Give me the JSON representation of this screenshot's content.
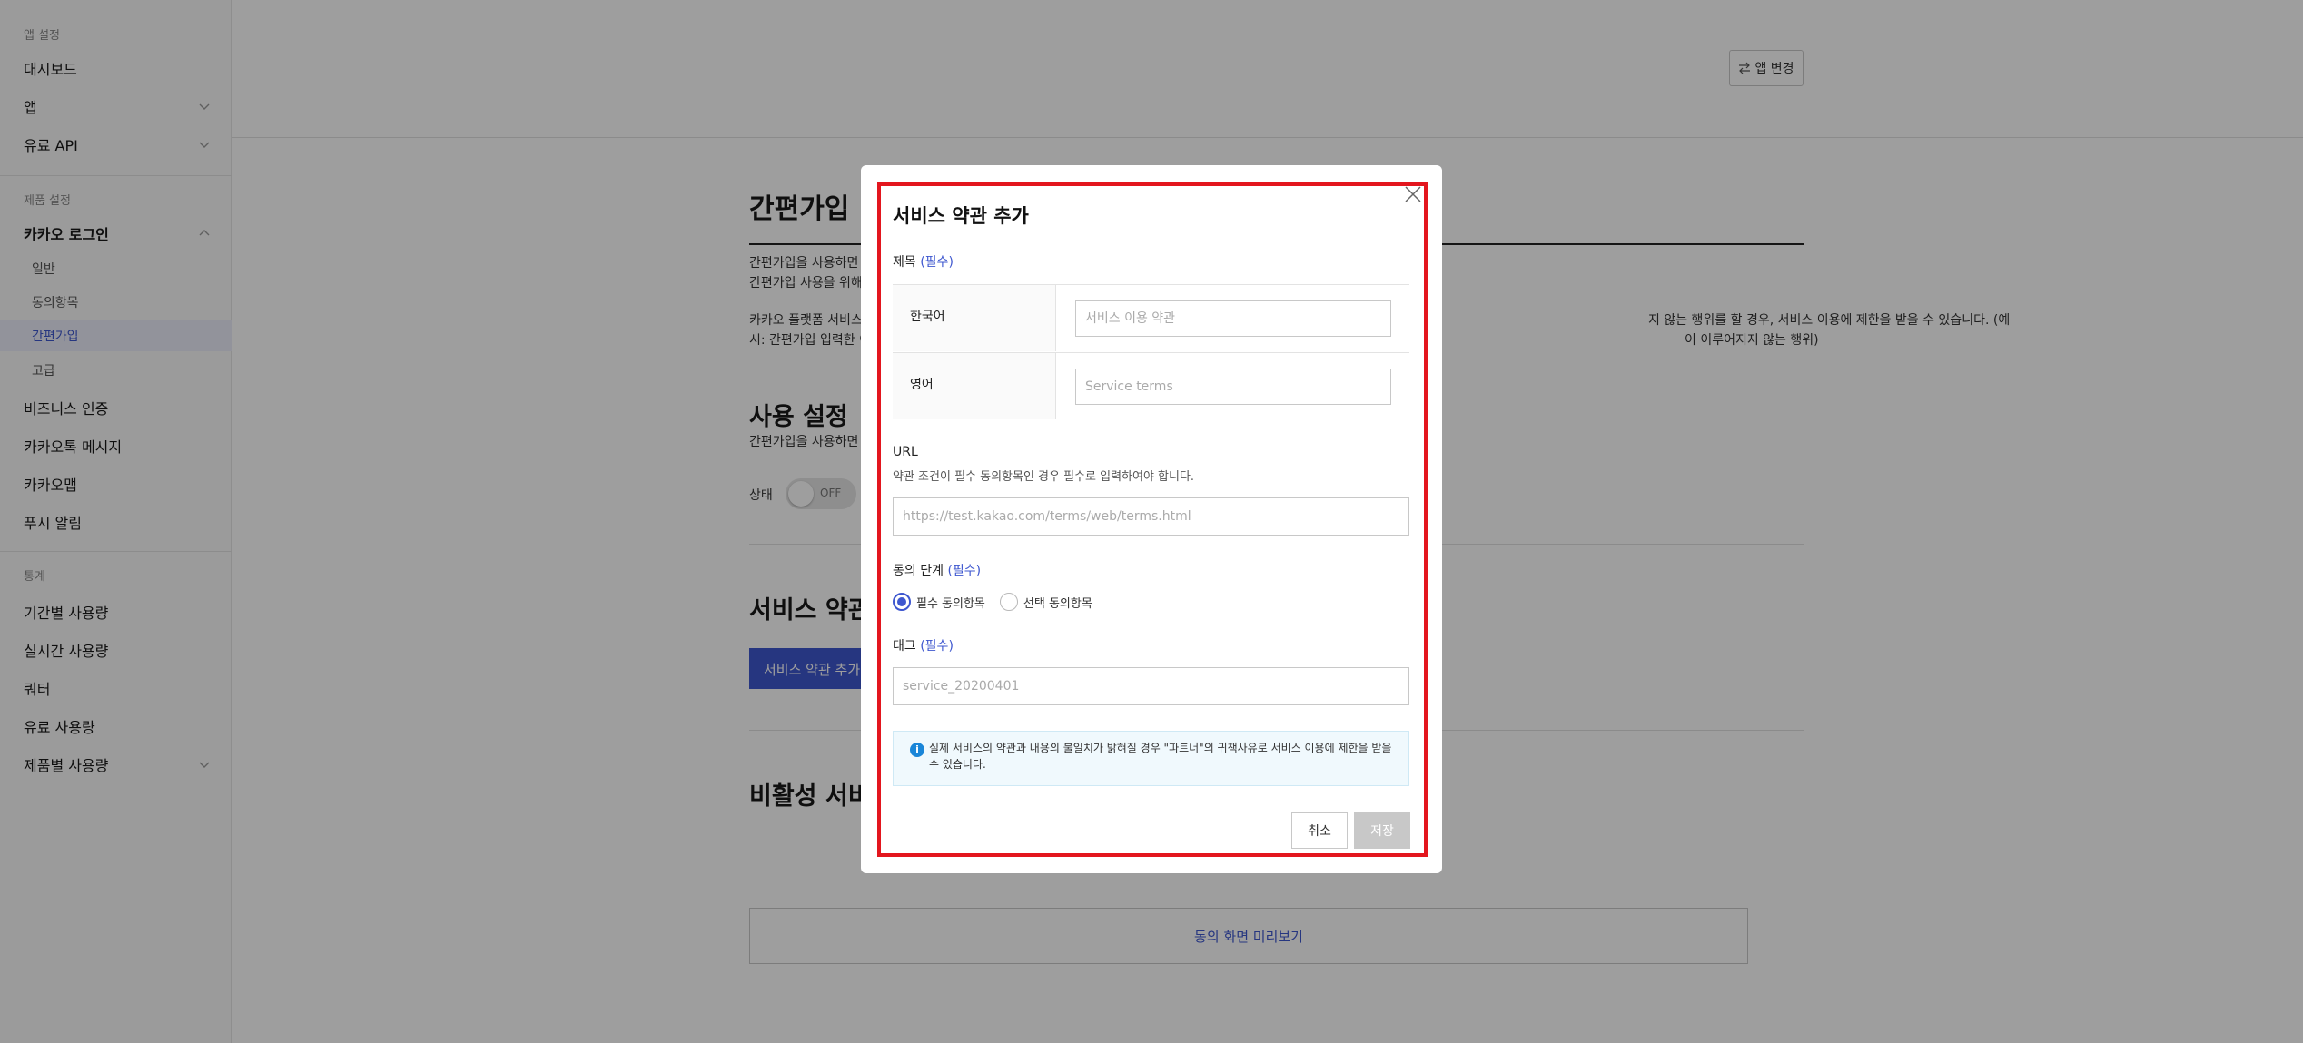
{
  "colors": {
    "accent": "#3e57cf",
    "highlight": "#e3161e",
    "notice_icon": "#1a86d8"
  },
  "sidebar": {
    "group_app": "앱 설정",
    "dashboard": "대시보드",
    "app": "앱",
    "paid_api": "유료 API",
    "group_product": "제품 설정",
    "kakao_login": "카카오 로그인",
    "sub_general": "일반",
    "sub_consent": "동의항목",
    "sub_simple_signup": "간편가입",
    "sub_advanced": "고급",
    "business_auth": "비즈니스 인증",
    "kakaotalk_message": "카카오톡 메시지",
    "kakao_moment": "카카오맵",
    "push": "푸시 알림",
    "group_stats": "통계",
    "usage_period": "기간별 사용량",
    "usage_realtime": "실시간 사용량",
    "quota": "쿼터",
    "paid_usage": "유료 사용량",
    "product_usage": "제품별 사용량"
  },
  "main": {
    "app_change": "앱 변경",
    "page_title": "간편가입",
    "desc1": "간편가입을 사용하면",
    "desc2": "간편가입 사용을 위해",
    "desc3_left": "카카오 플랫폼 서비스",
    "desc3_right": "지 않는 행위를 할 경우, 서비스 이용에 제한을 받을 수 있습니다. (예",
    "desc4_left": "시: 간편가입 입력한 이",
    "desc4_right": "이 이루어지지 않는 행위)",
    "usage_title": "사용 설정",
    "usage_desc": "간편가입을 사용하면",
    "status_label": "상태",
    "toggle_text": "OFF",
    "terms_title": "서비스 약관",
    "add_terms_button": "서비스 약관 추가",
    "inactive_title": "비활성 서비",
    "preview_button": "동의 화면 미리보기"
  },
  "modal": {
    "title": "서비스 약관 추가",
    "title_label": "제목",
    "required": "(필수)",
    "korean": "한국어",
    "korean_placeholder": "서비스 이용 약관",
    "english": "영어",
    "english_placeholder": "Service terms",
    "url_label": "URL",
    "url_help": "약관 조건이 필수 동의항목인 경우 필수로 입력하여야 합니다.",
    "url_placeholder": "https://test.kakao.com/terms/web/terms.html",
    "consent_level_label": "동의 단계",
    "radio_required": "필수 동의항목",
    "radio_optional": "선택 동의항목",
    "tag_label": "태그",
    "tag_placeholder": "service_20200401",
    "notice_line1": "실제 서비스의 약관과 내용의 불일치가 밝혀질 경우 \"파트너\"의 귀책사유로 서비스 이용에 제한을 받을",
    "notice_line2": "수 있습니다.",
    "cancel": "취소",
    "save": "저장"
  }
}
